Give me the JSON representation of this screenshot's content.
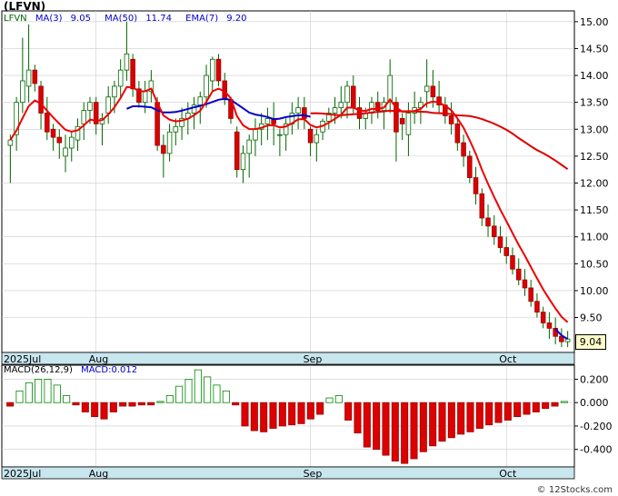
{
  "header": {
    "title": "(LFVN)"
  },
  "legend": {
    "ticker": "LFVN",
    "ma3_label": "MA(3)",
    "ma3_value": "9.05",
    "ma50_label": "MA(50)",
    "ma50_value": "11.74",
    "ema7_label": "EMA(7)",
    "ema7_value": "9.20"
  },
  "macd_legend": {
    "label": "MACD(26,12,9)",
    "value_label": "MACD:0.012"
  },
  "last_price": "9.04",
  "watermark": "© 12Stocks.com",
  "colors": {
    "up_candle": "#ffffff",
    "down_candle": "#dd0000",
    "wick": "#006600",
    "ma3": "#0000cc",
    "ma50": "#dd0000",
    "ema7": "#ee0000",
    "macd_pos": "#008800",
    "macd_neg": "#dd0000",
    "axis_band": "#c8e6ee",
    "grid": "#cccccc"
  },
  "chart_data": [
    {
      "type": "candlestick",
      "title": "(LFVN)",
      "ylim": [
        8.85,
        15.2
      ],
      "yticks": [
        "15.00",
        "14.50",
        "14.00",
        "13.50",
        "13.00",
        "12.50",
        "12.00",
        "11.50",
        "11.00",
        "10.50",
        "10.00",
        "9.50"
      ],
      "ytick_values": [
        15.0,
        14.5,
        14.0,
        13.5,
        13.0,
        12.5,
        12.0,
        11.5,
        11.0,
        10.5,
        10.0,
        9.5
      ],
      "x_labels": [
        {
          "label": "2025Jul",
          "index": 0
        },
        {
          "label": "Aug",
          "index": 14
        },
        {
          "label": "Sep",
          "index": 49
        },
        {
          "label": "Oct",
          "index": 81
        }
      ],
      "candles": [
        [
          12.7,
          12.9,
          12.0,
          12.8
        ],
        [
          12.9,
          13.6,
          12.6,
          13.5
        ],
        [
          13.5,
          14.7,
          13.3,
          13.9
        ],
        [
          13.8,
          14.95,
          13.5,
          14.1
        ],
        [
          14.1,
          14.2,
          13.7,
          13.85
        ],
        [
          13.8,
          13.9,
          13.0,
          13.3
        ],
        [
          13.3,
          13.6,
          12.8,
          12.95
        ],
        [
          13.0,
          13.1,
          12.6,
          12.85
        ],
        [
          12.85,
          13.0,
          12.45,
          12.75
        ],
        [
          12.5,
          12.9,
          12.2,
          12.65
        ],
        [
          12.65,
          12.95,
          12.4,
          12.85
        ],
        [
          12.8,
          13.2,
          12.6,
          13.05
        ],
        [
          13.1,
          13.5,
          12.8,
          13.35
        ],
        [
          13.35,
          13.6,
          13.1,
          13.5
        ],
        [
          13.5,
          13.6,
          12.9,
          13.1
        ],
        [
          13.1,
          13.3,
          12.7,
          13.2
        ],
        [
          13.3,
          13.8,
          13.1,
          13.6
        ],
        [
          13.6,
          13.9,
          13.3,
          13.8
        ],
        [
          13.8,
          14.3,
          13.6,
          14.1
        ],
        [
          14.1,
          15.0,
          13.9,
          14.4
        ],
        [
          14.3,
          14.4,
          13.6,
          13.75
        ],
        [
          13.75,
          13.9,
          13.4,
          13.5
        ],
        [
          13.5,
          13.9,
          13.3,
          13.7
        ],
        [
          13.7,
          14.1,
          13.5,
          13.9
        ],
        [
          13.5,
          13.6,
          12.6,
          12.7
        ],
        [
          12.7,
          12.9,
          12.1,
          12.55
        ],
        [
          12.55,
          13.1,
          12.4,
          12.95
        ],
        [
          12.95,
          13.2,
          12.7,
          13.05
        ],
        [
          13.05,
          13.4,
          12.8,
          13.2
        ],
        [
          13.2,
          13.5,
          12.9,
          13.3
        ],
        [
          13.3,
          13.6,
          13.0,
          13.45
        ],
        [
          13.45,
          13.7,
          13.1,
          13.6
        ],
        [
          13.6,
          14.2,
          13.4,
          14.0
        ],
        [
          13.9,
          14.35,
          13.7,
          14.3
        ],
        [
          14.3,
          14.4,
          13.8,
          13.9
        ],
        [
          13.9,
          14.05,
          13.45,
          13.55
        ],
        [
          13.55,
          13.6,
          13.1,
          13.2
        ],
        [
          12.95,
          13.05,
          12.1,
          12.25
        ],
        [
          12.25,
          12.7,
          12.0,
          12.55
        ],
        [
          12.55,
          12.9,
          12.1,
          12.8
        ],
        [
          12.8,
          13.2,
          12.5,
          13.0
        ],
        [
          13.0,
          13.3,
          12.7,
          13.1
        ],
        [
          13.1,
          13.4,
          12.8,
          13.2
        ],
        [
          13.2,
          13.5,
          12.7,
          13.1
        ],
        [
          12.9,
          13.0,
          12.5,
          12.9
        ],
        [
          12.9,
          13.2,
          12.6,
          13.1
        ],
        [
          13.1,
          13.5,
          12.9,
          13.3
        ],
        [
          13.3,
          13.6,
          13.0,
          13.4
        ],
        [
          13.4,
          13.6,
          13.0,
          13.2
        ],
        [
          13.0,
          13.05,
          12.5,
          12.75
        ],
        [
          12.75,
          13.0,
          12.4,
          12.9
        ],
        [
          12.95,
          13.2,
          12.8,
          13.15
        ],
        [
          13.15,
          13.4,
          13.0,
          13.3
        ],
        [
          13.3,
          13.6,
          13.1,
          13.4
        ],
        [
          13.4,
          13.8,
          13.2,
          13.5
        ],
        [
          13.5,
          13.9,
          13.2,
          13.8
        ],
        [
          13.8,
          14.0,
          13.3,
          13.4
        ],
        [
          13.4,
          13.6,
          13.0,
          13.2
        ],
        [
          13.2,
          13.4,
          13.0,
          13.3
        ],
        [
          13.3,
          13.6,
          13.1,
          13.5
        ],
        [
          13.5,
          13.7,
          13.2,
          13.35
        ],
        [
          13.35,
          13.6,
          13.0,
          13.5
        ],
        [
          13.5,
          14.3,
          13.3,
          14.0
        ],
        [
          13.5,
          13.6,
          12.4,
          12.95
        ],
        [
          13.2,
          13.3,
          12.8,
          13.1
        ],
        [
          12.9,
          13.5,
          12.5,
          13.3
        ],
        [
          13.3,
          13.7,
          13.1,
          13.4
        ],
        [
          13.4,
          13.6,
          13.1,
          13.5
        ],
        [
          13.7,
          14.3,
          13.4,
          13.8
        ],
        [
          13.8,
          14.1,
          13.4,
          13.6
        ],
        [
          13.6,
          13.9,
          13.3,
          13.45
        ],
        [
          13.45,
          13.6,
          13.1,
          13.25
        ],
        [
          13.25,
          13.5,
          12.9,
          13.1
        ],
        [
          13.1,
          13.2,
          12.6,
          12.75
        ],
        [
          12.75,
          12.9,
          12.3,
          12.5
        ],
        [
          12.5,
          12.6,
          12.0,
          12.1
        ],
        [
          12.1,
          12.3,
          11.6,
          11.8
        ],
        [
          11.8,
          11.9,
          11.2,
          11.35
        ],
        [
          11.35,
          11.6,
          11.0,
          11.2
        ],
        [
          11.2,
          11.4,
          10.85,
          11.0
        ],
        [
          11.0,
          11.2,
          10.7,
          10.8
        ],
        [
          10.8,
          11.0,
          10.5,
          10.65
        ],
        [
          10.65,
          10.8,
          10.3,
          10.4
        ],
        [
          10.4,
          10.6,
          10.1,
          10.2
        ],
        [
          10.2,
          10.4,
          9.9,
          10.05
        ],
        [
          10.05,
          10.2,
          9.7,
          9.8
        ],
        [
          9.8,
          9.95,
          9.5,
          9.6
        ],
        [
          9.6,
          9.7,
          9.3,
          9.4
        ],
        [
          9.4,
          9.6,
          9.1,
          9.3
        ],
        [
          9.3,
          9.5,
          9.0,
          9.15
        ],
        [
          9.15,
          9.3,
          8.95,
          9.05
        ],
        [
          9.05,
          9.25,
          8.95,
          9.1
        ]
      ]
    },
    {
      "type": "bar",
      "title": "MACD(26,12,9)",
      "ylim": [
        -0.55,
        0.32
      ],
      "yticks": [
        "0.200",
        "0.000",
        "-0.200",
        "-0.400"
      ],
      "ytick_values": [
        0.2,
        0.0,
        -0.2,
        -0.4
      ],
      "values": [
        -0.03,
        0.1,
        0.17,
        0.2,
        0.2,
        0.15,
        0.06,
        -0.02,
        -0.08,
        -0.12,
        -0.14,
        -0.08,
        -0.03,
        -0.03,
        -0.02,
        -0.02,
        0.01,
        0.06,
        0.14,
        0.2,
        0.28,
        0.22,
        0.15,
        0.1,
        -0.02,
        -0.2,
        -0.24,
        -0.25,
        -0.22,
        -0.2,
        -0.19,
        -0.18,
        -0.14,
        -0.1,
        0.04,
        0.06,
        -0.15,
        -0.26,
        -0.38,
        -0.4,
        -0.45,
        -0.5,
        -0.52,
        -0.48,
        -0.42,
        -0.37,
        -0.33,
        -0.3,
        -0.27,
        -0.25,
        -0.22,
        -0.19,
        -0.17,
        -0.15,
        -0.12,
        -0.1,
        -0.08,
        -0.05,
        -0.03,
        0.01
      ]
    }
  ]
}
